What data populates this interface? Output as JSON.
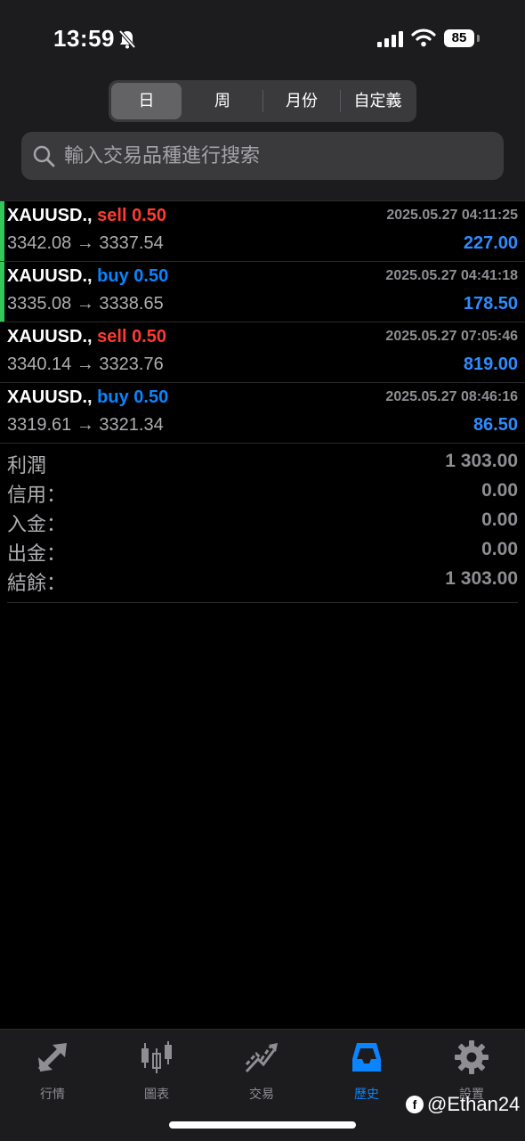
{
  "status_bar": {
    "time": "13:59",
    "battery": "85"
  },
  "period_tabs": [
    {
      "label": "日",
      "active": true
    },
    {
      "label": "周",
      "active": false
    },
    {
      "label": "月份",
      "active": false
    },
    {
      "label": "自定義",
      "active": false
    }
  ],
  "search": {
    "placeholder": "輸入交易品種進行搜索"
  },
  "trades": [
    {
      "symbol": "XAUUSD.,",
      "direction": "sell",
      "volume": "0.50",
      "datetime": "2025.05.27 04:11:25",
      "prices": "3342.08 → 3337.54",
      "profit": "227.00"
    },
    {
      "symbol": "XAUUSD.,",
      "direction": "buy",
      "volume": "0.50",
      "datetime": "2025.05.27 04:41:18",
      "prices": "3335.08 → 3338.65",
      "profit": "178.50"
    },
    {
      "symbol": "XAUUSD.,",
      "direction": "sell",
      "volume": "0.50",
      "datetime": "2025.05.27 07:05:46",
      "prices": "3340.14 → 3323.76",
      "profit": "819.00"
    },
    {
      "symbol": "XAUUSD.,",
      "direction": "buy",
      "volume": "0.50",
      "datetime": "2025.05.27 08:46:16",
      "prices": "3319.61 → 3321.34",
      "profit": "86.50"
    }
  ],
  "summary": [
    {
      "label": "利潤",
      "value": "1 303.00"
    },
    {
      "label": "信用：",
      "value": "0.00"
    },
    {
      "label": "入金：",
      "value": "0.00"
    },
    {
      "label": "出金：",
      "value": "0.00"
    },
    {
      "label": "結餘：",
      "value": "1 303.00"
    }
  ],
  "tab_bar": [
    {
      "label": "行情",
      "icon": "quotes-arrows-icon",
      "active": false
    },
    {
      "label": "圖表",
      "icon": "candlestick-chart-icon",
      "active": false
    },
    {
      "label": "交易",
      "icon": "trade-trend-icon",
      "active": false
    },
    {
      "label": "歷史",
      "icon": "history-inbox-icon",
      "active": true
    },
    {
      "label": "設置",
      "icon": "settings-gear-icon",
      "active": false
    }
  ],
  "watermark": "@Ethan24",
  "colors": {
    "sell": "#ff3b30",
    "buy": "#0a84ff",
    "accent": "#0a84ff",
    "indicator": "#34c759"
  }
}
